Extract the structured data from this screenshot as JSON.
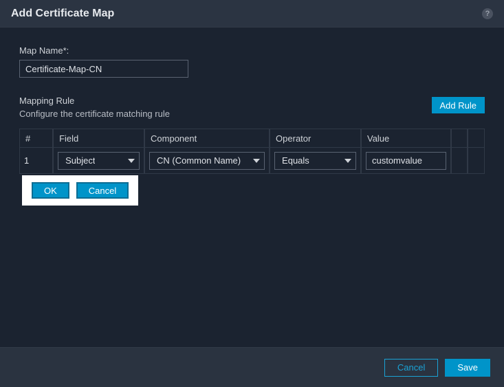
{
  "header": {
    "title": "Add Certificate Map",
    "help_icon_glyph": "?"
  },
  "form": {
    "map_name_label": "Map Name*:",
    "map_name_value": "Certificate-Map-CN"
  },
  "rules": {
    "section_title": "Mapping Rule",
    "section_sub": "Configure the certificate matching rule",
    "add_rule_label": "Add Rule",
    "columns": {
      "num": "#",
      "field": "Field",
      "component": "Component",
      "operator": "Operator",
      "value": "Value"
    },
    "rows": [
      {
        "num": "1",
        "field": "Subject",
        "component": "CN (Common Name)",
        "operator": "Equals",
        "value": "customvalue"
      }
    ],
    "row_actions": {
      "ok": "OK",
      "cancel": "Cancel"
    }
  },
  "footer": {
    "cancel": "Cancel",
    "save": "Save"
  }
}
